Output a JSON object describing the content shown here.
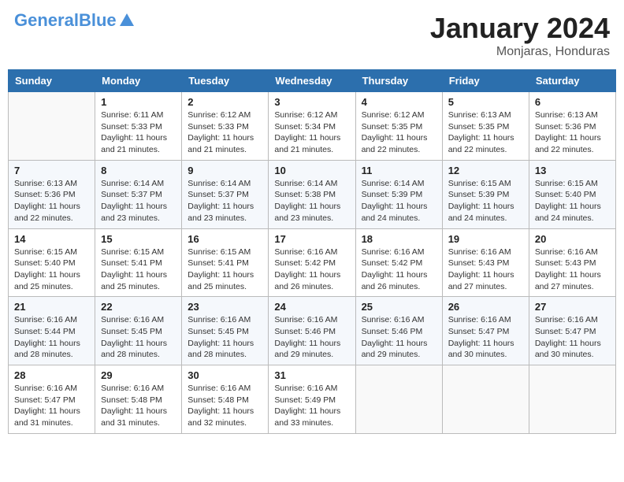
{
  "header": {
    "logo_main": "General",
    "logo_blue": "Blue",
    "month_title": "January 2024",
    "location": "Monjaras, Honduras"
  },
  "days_of_week": [
    "Sunday",
    "Monday",
    "Tuesday",
    "Wednesday",
    "Thursday",
    "Friday",
    "Saturday"
  ],
  "weeks": [
    [
      {
        "day": "",
        "sunrise": "",
        "sunset": "",
        "daylight": ""
      },
      {
        "day": "1",
        "sunrise": "Sunrise: 6:11 AM",
        "sunset": "Sunset: 5:33 PM",
        "daylight": "Daylight: 11 hours and 21 minutes."
      },
      {
        "day": "2",
        "sunrise": "Sunrise: 6:12 AM",
        "sunset": "Sunset: 5:33 PM",
        "daylight": "Daylight: 11 hours and 21 minutes."
      },
      {
        "day": "3",
        "sunrise": "Sunrise: 6:12 AM",
        "sunset": "Sunset: 5:34 PM",
        "daylight": "Daylight: 11 hours and 21 minutes."
      },
      {
        "day": "4",
        "sunrise": "Sunrise: 6:12 AM",
        "sunset": "Sunset: 5:35 PM",
        "daylight": "Daylight: 11 hours and 22 minutes."
      },
      {
        "day": "5",
        "sunrise": "Sunrise: 6:13 AM",
        "sunset": "Sunset: 5:35 PM",
        "daylight": "Daylight: 11 hours and 22 minutes."
      },
      {
        "day": "6",
        "sunrise": "Sunrise: 6:13 AM",
        "sunset": "Sunset: 5:36 PM",
        "daylight": "Daylight: 11 hours and 22 minutes."
      }
    ],
    [
      {
        "day": "7",
        "sunrise": "Sunrise: 6:13 AM",
        "sunset": "Sunset: 5:36 PM",
        "daylight": "Daylight: 11 hours and 22 minutes."
      },
      {
        "day": "8",
        "sunrise": "Sunrise: 6:14 AM",
        "sunset": "Sunset: 5:37 PM",
        "daylight": "Daylight: 11 hours and 23 minutes."
      },
      {
        "day": "9",
        "sunrise": "Sunrise: 6:14 AM",
        "sunset": "Sunset: 5:37 PM",
        "daylight": "Daylight: 11 hours and 23 minutes."
      },
      {
        "day": "10",
        "sunrise": "Sunrise: 6:14 AM",
        "sunset": "Sunset: 5:38 PM",
        "daylight": "Daylight: 11 hours and 23 minutes."
      },
      {
        "day": "11",
        "sunrise": "Sunrise: 6:14 AM",
        "sunset": "Sunset: 5:39 PM",
        "daylight": "Daylight: 11 hours and 24 minutes."
      },
      {
        "day": "12",
        "sunrise": "Sunrise: 6:15 AM",
        "sunset": "Sunset: 5:39 PM",
        "daylight": "Daylight: 11 hours and 24 minutes."
      },
      {
        "day": "13",
        "sunrise": "Sunrise: 6:15 AM",
        "sunset": "Sunset: 5:40 PM",
        "daylight": "Daylight: 11 hours and 24 minutes."
      }
    ],
    [
      {
        "day": "14",
        "sunrise": "Sunrise: 6:15 AM",
        "sunset": "Sunset: 5:40 PM",
        "daylight": "Daylight: 11 hours and 25 minutes."
      },
      {
        "day": "15",
        "sunrise": "Sunrise: 6:15 AM",
        "sunset": "Sunset: 5:41 PM",
        "daylight": "Daylight: 11 hours and 25 minutes."
      },
      {
        "day": "16",
        "sunrise": "Sunrise: 6:15 AM",
        "sunset": "Sunset: 5:41 PM",
        "daylight": "Daylight: 11 hours and 25 minutes."
      },
      {
        "day": "17",
        "sunrise": "Sunrise: 6:16 AM",
        "sunset": "Sunset: 5:42 PM",
        "daylight": "Daylight: 11 hours and 26 minutes."
      },
      {
        "day": "18",
        "sunrise": "Sunrise: 6:16 AM",
        "sunset": "Sunset: 5:42 PM",
        "daylight": "Daylight: 11 hours and 26 minutes."
      },
      {
        "day": "19",
        "sunrise": "Sunrise: 6:16 AM",
        "sunset": "Sunset: 5:43 PM",
        "daylight": "Daylight: 11 hours and 27 minutes."
      },
      {
        "day": "20",
        "sunrise": "Sunrise: 6:16 AM",
        "sunset": "Sunset: 5:43 PM",
        "daylight": "Daylight: 11 hours and 27 minutes."
      }
    ],
    [
      {
        "day": "21",
        "sunrise": "Sunrise: 6:16 AM",
        "sunset": "Sunset: 5:44 PM",
        "daylight": "Daylight: 11 hours and 28 minutes."
      },
      {
        "day": "22",
        "sunrise": "Sunrise: 6:16 AM",
        "sunset": "Sunset: 5:45 PM",
        "daylight": "Daylight: 11 hours and 28 minutes."
      },
      {
        "day": "23",
        "sunrise": "Sunrise: 6:16 AM",
        "sunset": "Sunset: 5:45 PM",
        "daylight": "Daylight: 11 hours and 28 minutes."
      },
      {
        "day": "24",
        "sunrise": "Sunrise: 6:16 AM",
        "sunset": "Sunset: 5:46 PM",
        "daylight": "Daylight: 11 hours and 29 minutes."
      },
      {
        "day": "25",
        "sunrise": "Sunrise: 6:16 AM",
        "sunset": "Sunset: 5:46 PM",
        "daylight": "Daylight: 11 hours and 29 minutes."
      },
      {
        "day": "26",
        "sunrise": "Sunrise: 6:16 AM",
        "sunset": "Sunset: 5:47 PM",
        "daylight": "Daylight: 11 hours and 30 minutes."
      },
      {
        "day": "27",
        "sunrise": "Sunrise: 6:16 AM",
        "sunset": "Sunset: 5:47 PM",
        "daylight": "Daylight: 11 hours and 30 minutes."
      }
    ],
    [
      {
        "day": "28",
        "sunrise": "Sunrise: 6:16 AM",
        "sunset": "Sunset: 5:47 PM",
        "daylight": "Daylight: 11 hours and 31 minutes."
      },
      {
        "day": "29",
        "sunrise": "Sunrise: 6:16 AM",
        "sunset": "Sunset: 5:48 PM",
        "daylight": "Daylight: 11 hours and 31 minutes."
      },
      {
        "day": "30",
        "sunrise": "Sunrise: 6:16 AM",
        "sunset": "Sunset: 5:48 PM",
        "daylight": "Daylight: 11 hours and 32 minutes."
      },
      {
        "day": "31",
        "sunrise": "Sunrise: 6:16 AM",
        "sunset": "Sunset: 5:49 PM",
        "daylight": "Daylight: 11 hours and 33 minutes."
      },
      {
        "day": "",
        "sunrise": "",
        "sunset": "",
        "daylight": ""
      },
      {
        "day": "",
        "sunrise": "",
        "sunset": "",
        "daylight": ""
      },
      {
        "day": "",
        "sunrise": "",
        "sunset": "",
        "daylight": ""
      }
    ]
  ]
}
